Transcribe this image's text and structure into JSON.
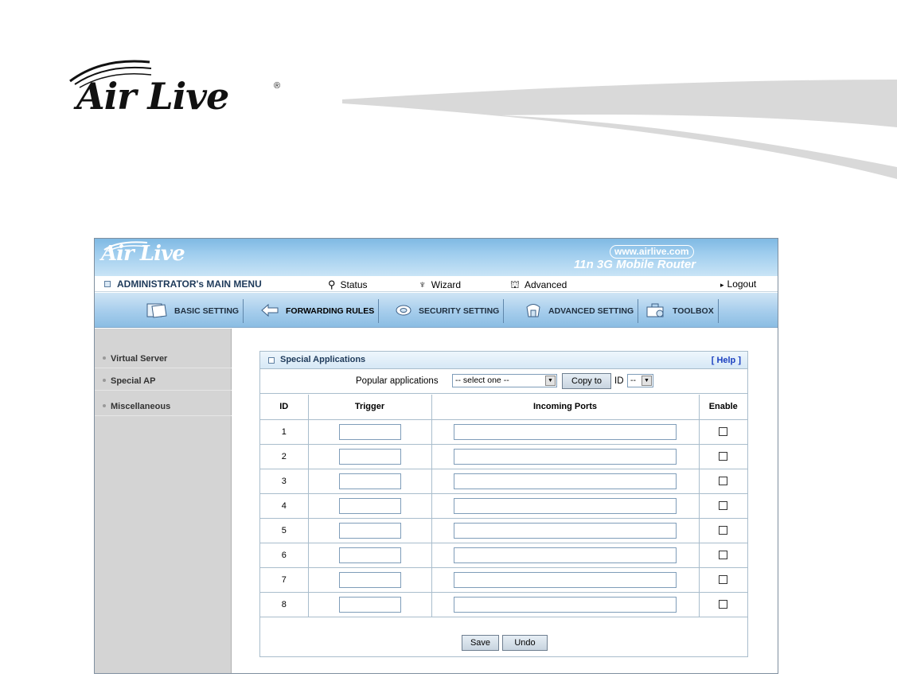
{
  "page_header": {
    "brand": "Air Live",
    "registered": "®"
  },
  "ui": {
    "banner": {
      "brand": "Air Live",
      "url": "www.airlive.com",
      "model": "11n 3G Mobile Router"
    },
    "menu": {
      "main": "ADMINISTRATOR's MAIN MENU",
      "status": "Status",
      "wizard": "Wizard",
      "advanced": "Advanced",
      "logout": "Logout"
    },
    "tabs": [
      {
        "label": "BASIC SETTING",
        "icon": "notebook-icon"
      },
      {
        "label": "FORWARDING RULES",
        "icon": "arrows-icon"
      },
      {
        "label": "SECURITY SETTING",
        "icon": "shield-icon"
      },
      {
        "label": "ADVANCED SETTING",
        "icon": "advanced-icon"
      },
      {
        "label": "TOOLBOX",
        "icon": "toolbox-icon"
      }
    ],
    "active_tab": "FORWARDING RULES",
    "sidebar": [
      "Virtual Server",
      "Special AP",
      "Miscellaneous"
    ],
    "panel": {
      "title": "Special Applications",
      "help": "[ Help ]",
      "popular_label": "Popular applications",
      "popular_selected": "-- select one --",
      "copy_button": "Copy to",
      "id_label": "ID",
      "id_selected": "--",
      "columns": {
        "id": "ID",
        "trigger": "Trigger",
        "incoming": "Incoming Ports",
        "enable": "Enable"
      },
      "rows": [
        {
          "id": "1",
          "trigger": "",
          "incoming": "",
          "enabled": false
        },
        {
          "id": "2",
          "trigger": "",
          "incoming": "",
          "enabled": false
        },
        {
          "id": "3",
          "trigger": "",
          "incoming": "",
          "enabled": false
        },
        {
          "id": "4",
          "trigger": "",
          "incoming": "",
          "enabled": false
        },
        {
          "id": "5",
          "trigger": "",
          "incoming": "",
          "enabled": false
        },
        {
          "id": "6",
          "trigger": "",
          "incoming": "",
          "enabled": false
        },
        {
          "id": "7",
          "trigger": "",
          "incoming": "",
          "enabled": false
        },
        {
          "id": "8",
          "trigger": "",
          "incoming": "",
          "enabled": false
        }
      ],
      "save_button": "Save",
      "undo_button": "Undo"
    }
  },
  "colors": {
    "banner": "#9fcdee",
    "help_link": "#1a3fc0",
    "sidebar": "#d4d4d4"
  }
}
